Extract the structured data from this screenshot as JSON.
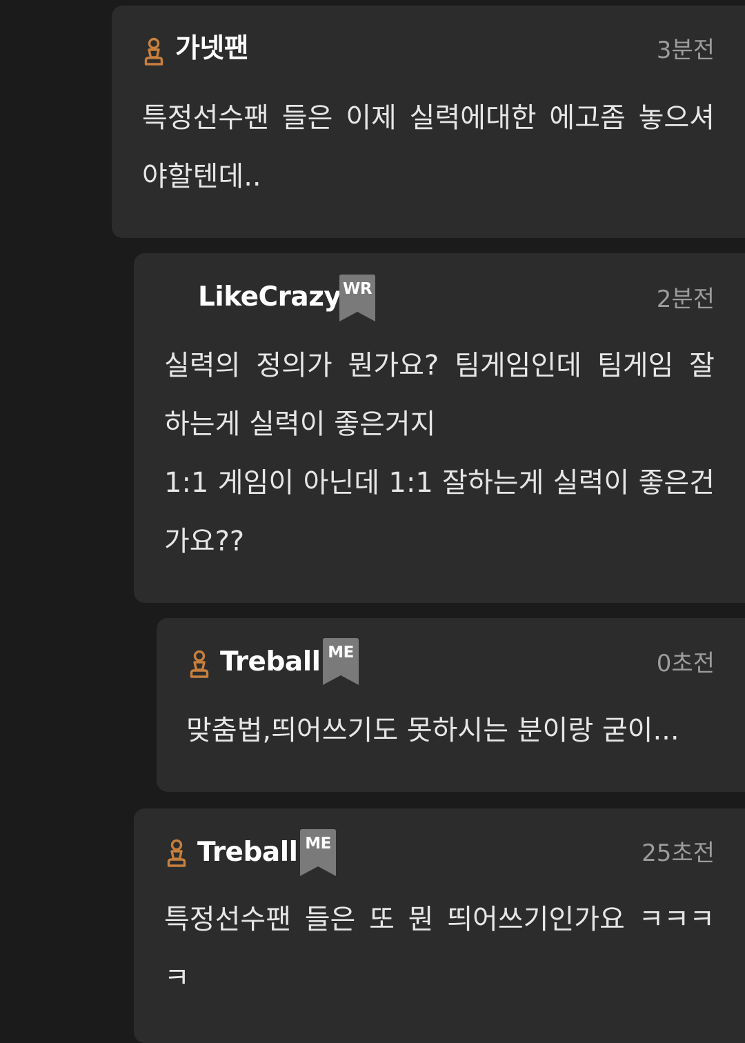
{
  "colors": {
    "background": "#1b1b1b",
    "card": "#2c2c2c",
    "username": "#ffffff",
    "timestamp": "#9c9c9c",
    "body_text": "#e6e6e6",
    "badge": "#7a7a7a",
    "user_icon": "#c8803e"
  },
  "comments": [
    {
      "user_icon": "pawn-icon",
      "username": "가넷팬",
      "badge": "",
      "time": "3분전",
      "lines": [
        "특정선수팬 들은 이제 실력에대한 에고좀 놓으셔",
        "야할텐데.."
      ]
    },
    {
      "user_icon": "",
      "username": "LikeCrazy",
      "badge": "WR",
      "time": "2분전",
      "lines": [
        "실력의 정의가 뭔가요? 팀게임인데 팀게임 잘",
        "하는게 실력이 좋은거지",
        "1:1 게임이 아닌데 1:1 잘하는게 실력이 좋은건",
        "가요??"
      ]
    },
    {
      "user_icon": "pawn-icon",
      "username": "Treball",
      "badge": "ME",
      "time": "0초전",
      "lines": [
        "맞춤법,띄어쓰기도 못하시는 분이랑 굳이..."
      ]
    },
    {
      "user_icon": "pawn-icon",
      "username": "Treball",
      "badge": "ME",
      "time": "25초전",
      "lines": [
        "특정선수팬 들은 또 뭔 띄어쓰기인가요 ㅋㅋㅋ",
        "ㅋ"
      ]
    }
  ]
}
